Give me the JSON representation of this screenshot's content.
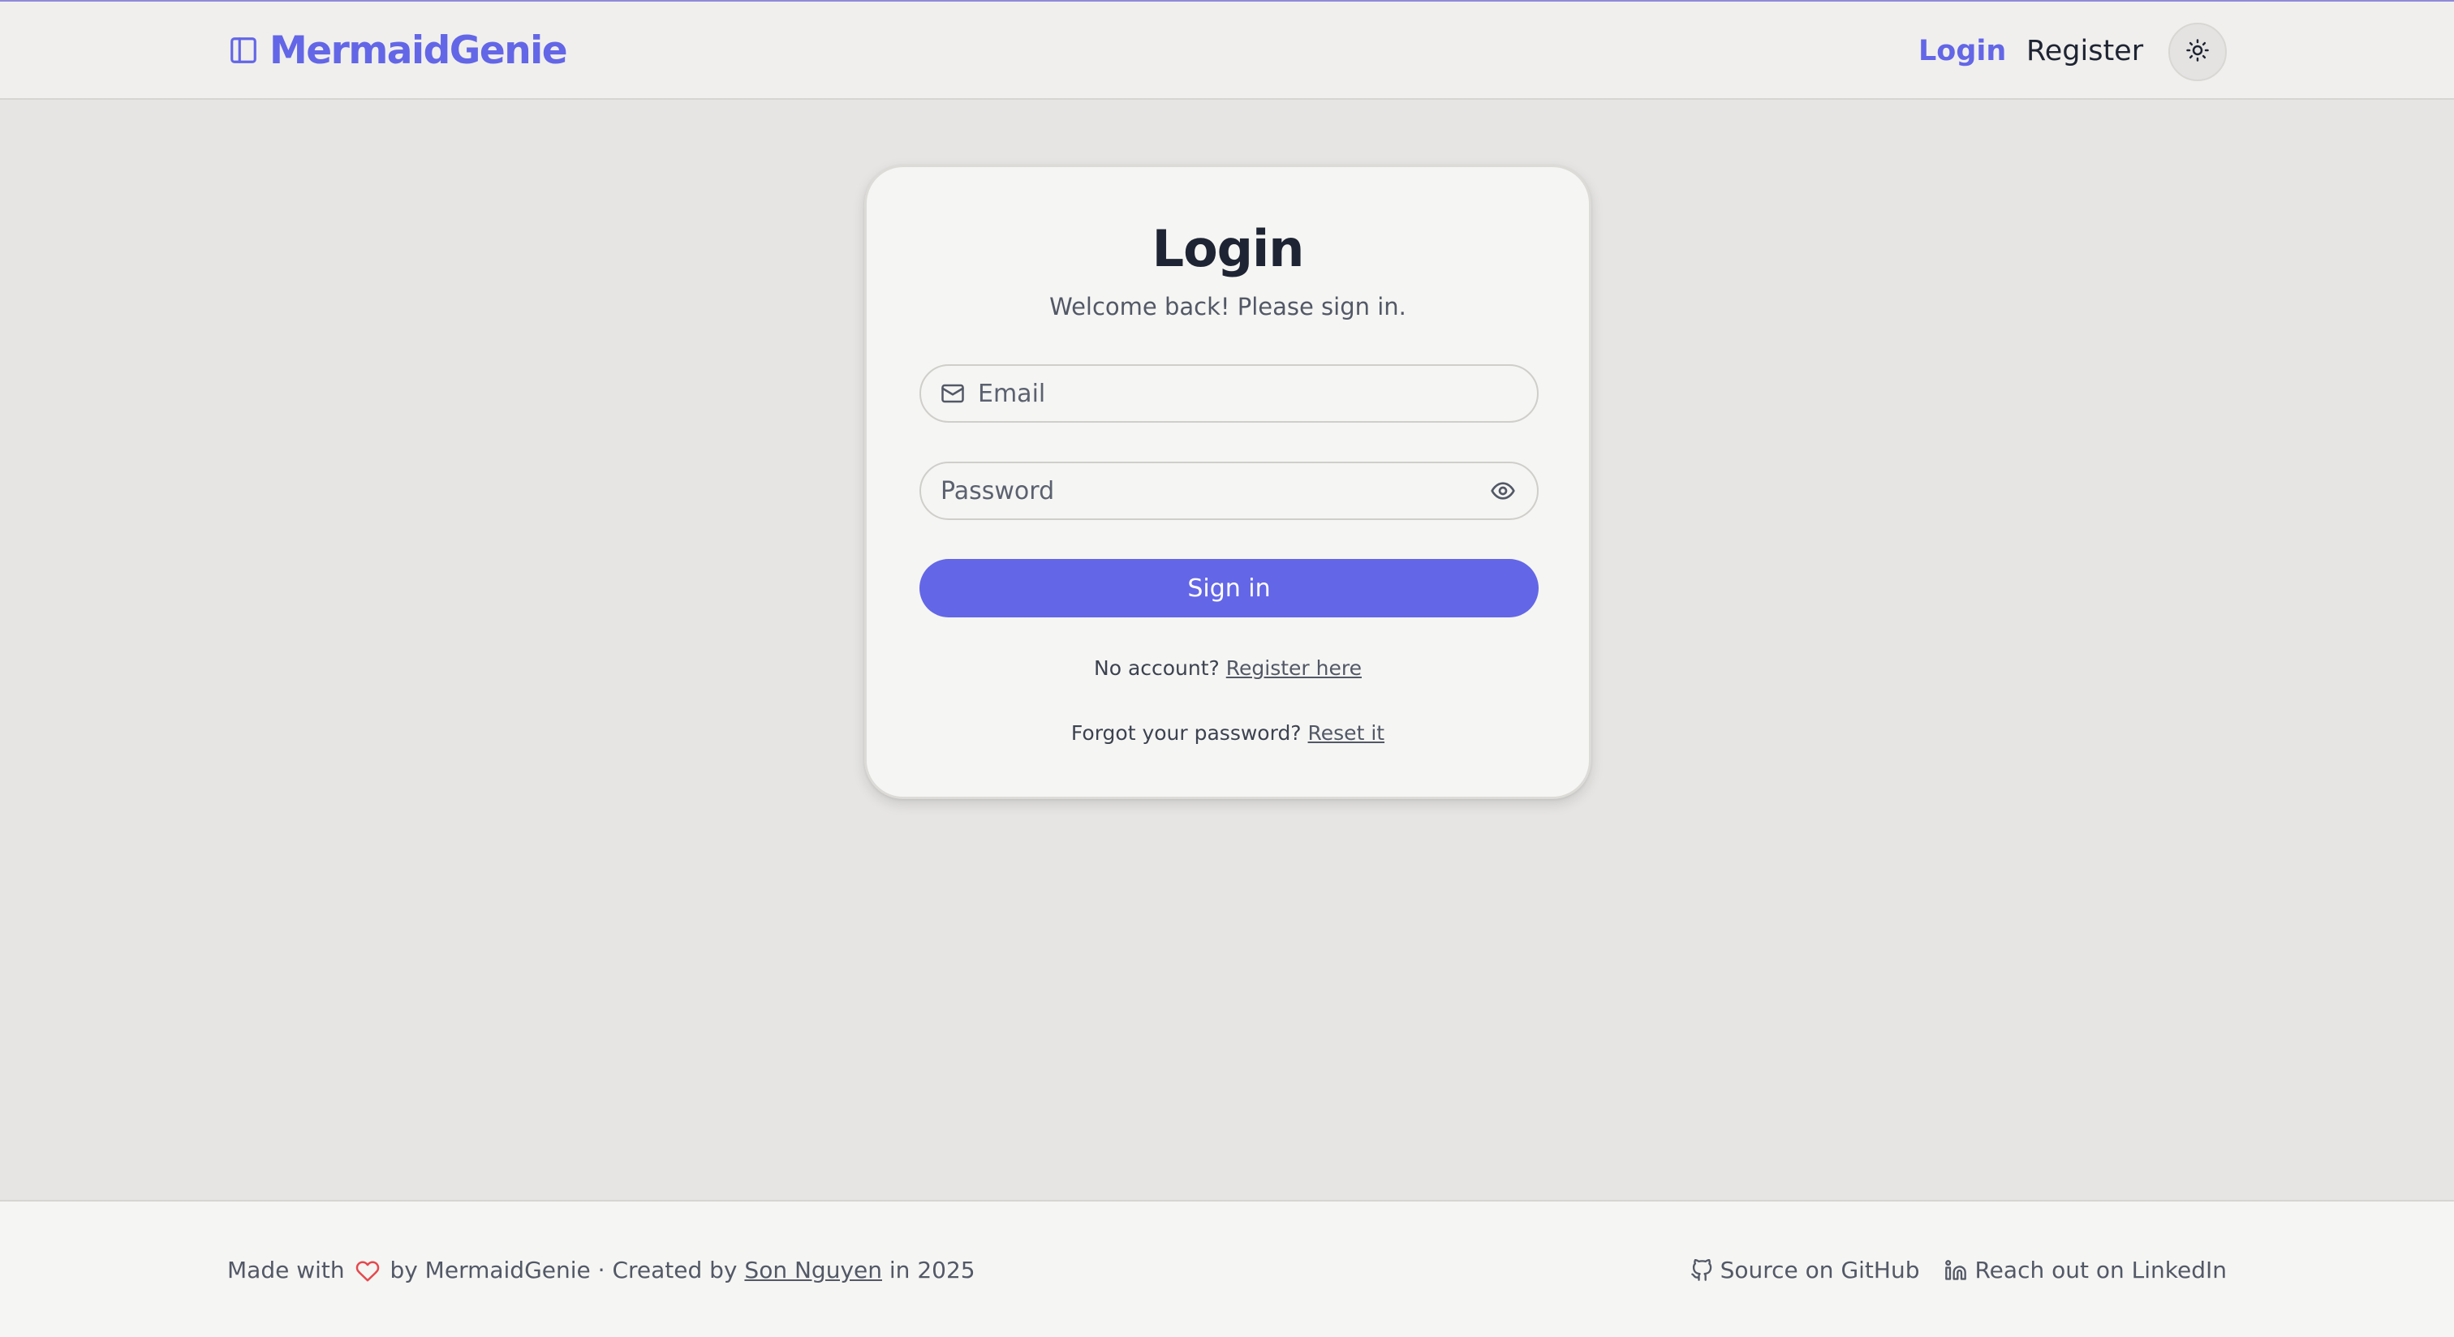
{
  "header": {
    "brand": "MermaidGenie",
    "brand_icon": "sidebar-panel-icon",
    "nav": {
      "login": "Login",
      "register": "Register"
    },
    "theme_icon": "sun-icon",
    "accent_color": "#6366e6"
  },
  "login_card": {
    "title": "Login",
    "subtitle": "Welcome back! Please sign in.",
    "email": {
      "placeholder": "Email",
      "icon": "mail-icon"
    },
    "password": {
      "placeholder": "Password",
      "toggle_icon": "eye-icon"
    },
    "submit_label": "Sign in",
    "register_prompt": "No account?",
    "register_link": "Register here",
    "forgot_prompt": "Forgot your password?",
    "forgot_link": "Reset it"
  },
  "footer": {
    "made_with": "Made with",
    "by_text": "by MermaidGenie · Created by",
    "author": "Son Nguyen",
    "year_text": "in 2025",
    "heart_color": "#e5484d",
    "github_label": "Source on GitHub",
    "linkedin_label": "Reach out on LinkedIn"
  }
}
